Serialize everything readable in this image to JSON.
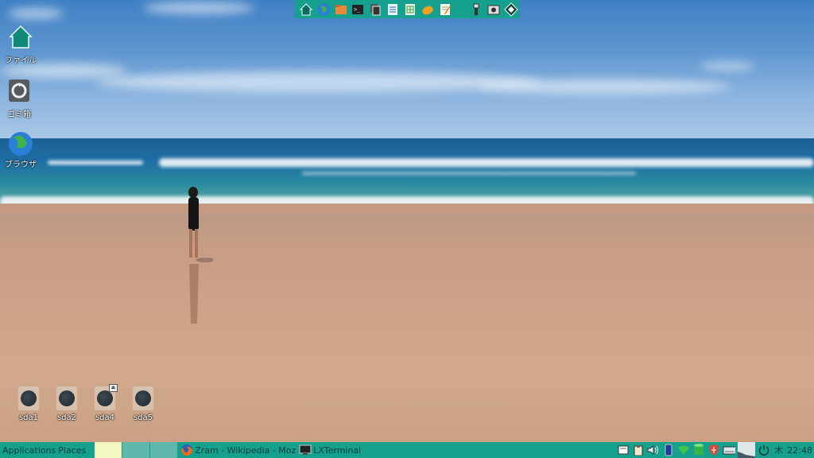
{
  "desktop": {
    "icons": [
      {
        "label": "ファイル",
        "icon": "home-folder-icon"
      },
      {
        "label": "ゴミ箱",
        "icon": "trash-icon"
      },
      {
        "label": "ブラウザ",
        "icon": "globe-icon"
      }
    ],
    "drives": [
      {
        "label": "sda1"
      },
      {
        "label": "sda2"
      },
      {
        "label": "sda4"
      },
      {
        "label": "sda5"
      }
    ]
  },
  "launcher": {
    "background": "#16a08e",
    "items": [
      "home-icon",
      "globe-icon",
      "folder-icon",
      "terminal-icon",
      "copy-icon",
      "document-icon",
      "spreadsheet-icon",
      "paint-icon",
      "text-editor-icon",
      "usb-icon",
      "screenshot-icon",
      "diamond-icon"
    ]
  },
  "panel": {
    "background": "#16a08e",
    "menu_applications": "Applications",
    "menu_places": "Places",
    "workspace_colors": [
      "#f4f7c0",
      "#5fb8ab",
      "#5fb8ab"
    ],
    "tasks": [
      {
        "label": "Zram - Wikipedia - Moz",
        "icon": "firefox-icon"
      },
      {
        "label": "LXTerminal",
        "icon": "terminal-icon"
      }
    ],
    "tray": [
      "notes-icon",
      "clipboard-icon",
      "volume-icon",
      "phone-icon",
      "wifi-icon",
      "database-icon",
      "shield-icon",
      "keyboard-icon",
      "cpu-graph-icon",
      "power-icon"
    ],
    "clock_day": "木",
    "clock_time": "22:48"
  }
}
